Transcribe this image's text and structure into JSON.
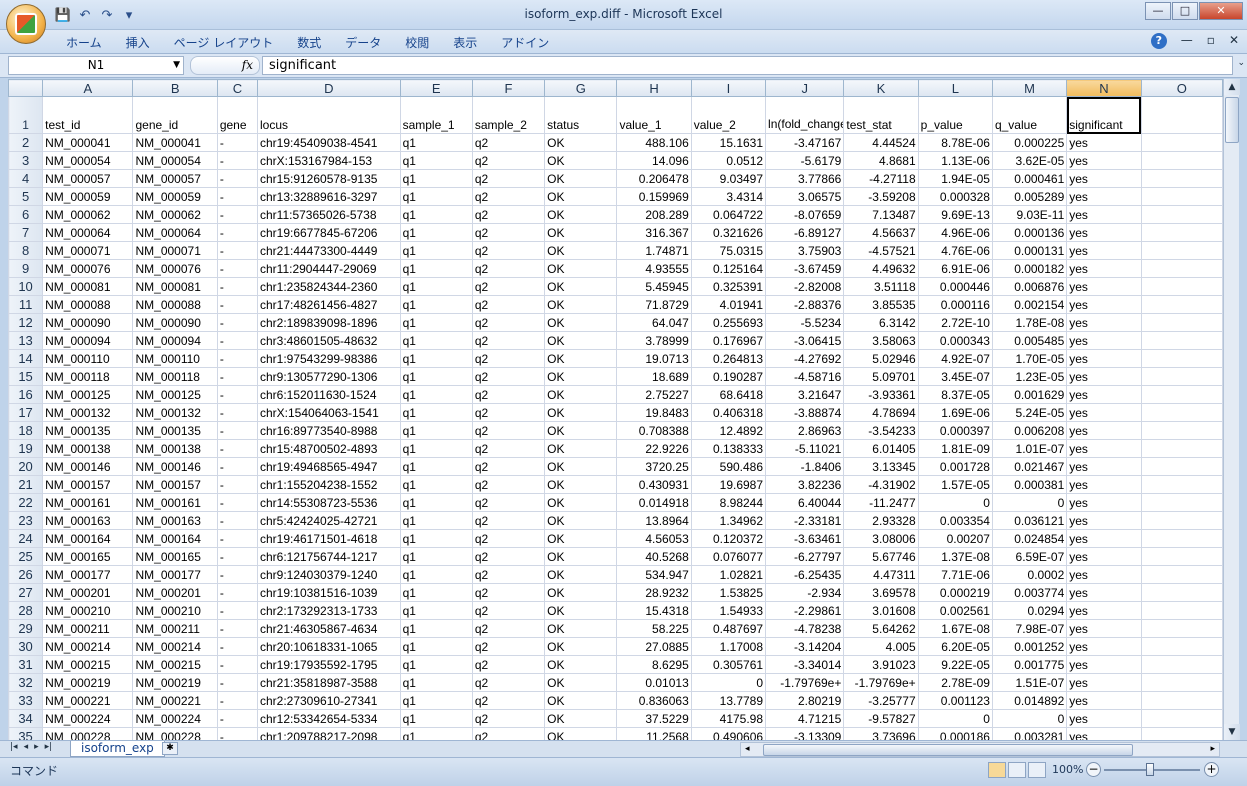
{
  "window": {
    "title": "isoform_exp.diff - Microsoft Excel",
    "controls": {
      "minimize": "—",
      "maximize": "□",
      "close": "✕"
    }
  },
  "quick_access": {
    "save": "💾",
    "undo": "↶",
    "redo": "↷",
    "customize": "▾"
  },
  "ribbon": {
    "tabs": [
      "ホーム",
      "挿入",
      "ページ レイアウト",
      "数式",
      "データ",
      "校閲",
      "表示",
      "アドイン"
    ],
    "help": "?",
    "doc_min": "—",
    "doc_restore": "▫",
    "doc_close": "✕"
  },
  "formula_bar": {
    "name_box": "N1",
    "fx": "fx",
    "content": "significant"
  },
  "columns": [
    "A",
    "B",
    "C",
    "D",
    "E",
    "F",
    "G",
    "H",
    "I",
    "J",
    "K",
    "L",
    "M",
    "N",
    "O"
  ],
  "selected_column": "N",
  "header_row": {
    "row": "1",
    "cells": [
      "test_id",
      "gene_id",
      "gene",
      "locus",
      "sample_1",
      "sample_2",
      "status",
      "value_1",
      "value_2",
      "ln(fold_change)",
      "test_stat",
      "p_value",
      "q_value",
      "significant",
      ""
    ]
  },
  "rows": [
    {
      "n": "2",
      "test_id": "NM_000041",
      "gene_id": "NM_000041",
      "gene": "-",
      "locus": "chr19:45409038-4541",
      "s1": "q1",
      "s2": "q2",
      "status": "OK",
      "v1": "488.106",
      "v2": "15.1631",
      "lfc": "-3.47167",
      "ts": "4.44524",
      "p": "8.78E-06",
      "q": "0.000225",
      "sig": "yes"
    },
    {
      "n": "3",
      "test_id": "NM_000054",
      "gene_id": "NM_000054",
      "gene": "-",
      "locus": "chrX:153167984-153",
      "s1": "q1",
      "s2": "q2",
      "status": "OK",
      "v1": "14.096",
      "v2": "0.0512",
      "lfc": "-5.6179",
      "ts": "4.8681",
      "p": "1.13E-06",
      "q": "3.62E-05",
      "sig": "yes"
    },
    {
      "n": "4",
      "test_id": "NM_000057",
      "gene_id": "NM_000057",
      "gene": "-",
      "locus": "chr15:91260578-9135",
      "s1": "q1",
      "s2": "q2",
      "status": "OK",
      "v1": "0.206478",
      "v2": "9.03497",
      "lfc": "3.77866",
      "ts": "-4.27118",
      "p": "1.94E-05",
      "q": "0.000461",
      "sig": "yes"
    },
    {
      "n": "5",
      "test_id": "NM_000059",
      "gene_id": "NM_000059",
      "gene": "-",
      "locus": "chr13:32889616-3297",
      "s1": "q1",
      "s2": "q2",
      "status": "OK",
      "v1": "0.159969",
      "v2": "3.4314",
      "lfc": "3.06575",
      "ts": "-3.59208",
      "p": "0.000328",
      "q": "0.005289",
      "sig": "yes"
    },
    {
      "n": "6",
      "test_id": "NM_000062",
      "gene_id": "NM_000062",
      "gene": "-",
      "locus": "chr11:57365026-5738",
      "s1": "q1",
      "s2": "q2",
      "status": "OK",
      "v1": "208.289",
      "v2": "0.064722",
      "lfc": "-8.07659",
      "ts": "7.13487",
      "p": "9.69E-13",
      "q": "9.03E-11",
      "sig": "yes"
    },
    {
      "n": "7",
      "test_id": "NM_000064",
      "gene_id": "NM_000064",
      "gene": "-",
      "locus": "chr19:6677845-67206",
      "s1": "q1",
      "s2": "q2",
      "status": "OK",
      "v1": "316.367",
      "v2": "0.321626",
      "lfc": "-6.89127",
      "ts": "4.56637",
      "p": "4.96E-06",
      "q": "0.000136",
      "sig": "yes"
    },
    {
      "n": "8",
      "test_id": "NM_000071",
      "gene_id": "NM_000071",
      "gene": "-",
      "locus": "chr21:44473300-4449",
      "s1": "q1",
      "s2": "q2",
      "status": "OK",
      "v1": "1.74871",
      "v2": "75.0315",
      "lfc": "3.75903",
      "ts": "-4.57521",
      "p": "4.76E-06",
      "q": "0.000131",
      "sig": "yes"
    },
    {
      "n": "9",
      "test_id": "NM_000076",
      "gene_id": "NM_000076",
      "gene": "-",
      "locus": "chr11:2904447-29069",
      "s1": "q1",
      "s2": "q2",
      "status": "OK",
      "v1": "4.93555",
      "v2": "0.125164",
      "lfc": "-3.67459",
      "ts": "4.49632",
      "p": "6.91E-06",
      "q": "0.000182",
      "sig": "yes"
    },
    {
      "n": "10",
      "test_id": "NM_000081",
      "gene_id": "NM_000081",
      "gene": "-",
      "locus": "chr1:235824344-2360",
      "s1": "q1",
      "s2": "q2",
      "status": "OK",
      "v1": "5.45945",
      "v2": "0.325391",
      "lfc": "-2.82008",
      "ts": "3.51118",
      "p": "0.000446",
      "q": "0.006876",
      "sig": "yes"
    },
    {
      "n": "11",
      "test_id": "NM_000088",
      "gene_id": "NM_000088",
      "gene": "-",
      "locus": "chr17:48261456-4827",
      "s1": "q1",
      "s2": "q2",
      "status": "OK",
      "v1": "71.8729",
      "v2": "4.01941",
      "lfc": "-2.88376",
      "ts": "3.85535",
      "p": "0.000116",
      "q": "0.002154",
      "sig": "yes"
    },
    {
      "n": "12",
      "test_id": "NM_000090",
      "gene_id": "NM_000090",
      "gene": "-",
      "locus": "chr2:189839098-1896",
      "s1": "q1",
      "s2": "q2",
      "status": "OK",
      "v1": "64.047",
      "v2": "0.255693",
      "lfc": "-5.5234",
      "ts": "6.3142",
      "p": "2.72E-10",
      "q": "1.78E-08",
      "sig": "yes"
    },
    {
      "n": "13",
      "test_id": "NM_000094",
      "gene_id": "NM_000094",
      "gene": "-",
      "locus": "chr3:48601505-48632",
      "s1": "q1",
      "s2": "q2",
      "status": "OK",
      "v1": "3.78999",
      "v2": "0.176967",
      "lfc": "-3.06415",
      "ts": "3.58063",
      "p": "0.000343",
      "q": "0.005485",
      "sig": "yes"
    },
    {
      "n": "14",
      "test_id": "NM_000110",
      "gene_id": "NM_000110",
      "gene": "-",
      "locus": "chr1:97543299-98386",
      "s1": "q1",
      "s2": "q2",
      "status": "OK",
      "v1": "19.0713",
      "v2": "0.264813",
      "lfc": "-4.27692",
      "ts": "5.02946",
      "p": "4.92E-07",
      "q": "1.70E-05",
      "sig": "yes"
    },
    {
      "n": "15",
      "test_id": "NM_000118",
      "gene_id": "NM_000118",
      "gene": "-",
      "locus": "chr9:130577290-1306",
      "s1": "q1",
      "s2": "q2",
      "status": "OK",
      "v1": "18.689",
      "v2": "0.190287",
      "lfc": "-4.58716",
      "ts": "5.09701",
      "p": "3.45E-07",
      "q": "1.23E-05",
      "sig": "yes"
    },
    {
      "n": "16",
      "test_id": "NM_000125",
      "gene_id": "NM_000125",
      "gene": "-",
      "locus": "chr6:152011630-1524",
      "s1": "q1",
      "s2": "q2",
      "status": "OK",
      "v1": "2.75227",
      "v2": "68.6418",
      "lfc": "3.21647",
      "ts": "-3.93361",
      "p": "8.37E-05",
      "q": "0.001629",
      "sig": "yes"
    },
    {
      "n": "17",
      "test_id": "NM_000132",
      "gene_id": "NM_000132",
      "gene": "-",
      "locus": "chrX:154064063-1541",
      "s1": "q1",
      "s2": "q2",
      "status": "OK",
      "v1": "19.8483",
      "v2": "0.406318",
      "lfc": "-3.88874",
      "ts": "4.78694",
      "p": "1.69E-06",
      "q": "5.24E-05",
      "sig": "yes"
    },
    {
      "n": "18",
      "test_id": "NM_000135",
      "gene_id": "NM_000135",
      "gene": "-",
      "locus": "chr16:89773540-8988",
      "s1": "q1",
      "s2": "q2",
      "status": "OK",
      "v1": "0.708388",
      "v2": "12.4892",
      "lfc": "2.86963",
      "ts": "-3.54233",
      "p": "0.000397",
      "q": "0.006208",
      "sig": "yes"
    },
    {
      "n": "19",
      "test_id": "NM_000138",
      "gene_id": "NM_000138",
      "gene": "-",
      "locus": "chr15:48700502-4893",
      "s1": "q1",
      "s2": "q2",
      "status": "OK",
      "v1": "22.9226",
      "v2": "0.138333",
      "lfc": "-5.11021",
      "ts": "6.01405",
      "p": "1.81E-09",
      "q": "1.01E-07",
      "sig": "yes"
    },
    {
      "n": "20",
      "test_id": "NM_000146",
      "gene_id": "NM_000146",
      "gene": "-",
      "locus": "chr19:49468565-4947",
      "s1": "q1",
      "s2": "q2",
      "status": "OK",
      "v1": "3720.25",
      "v2": "590.486",
      "lfc": "-1.8406",
      "ts": "3.13345",
      "p": "0.001728",
      "q": "0.021467",
      "sig": "yes"
    },
    {
      "n": "21",
      "test_id": "NM_000157",
      "gene_id": "NM_000157",
      "gene": "-",
      "locus": "chr1:155204238-1552",
      "s1": "q1",
      "s2": "q2",
      "status": "OK",
      "v1": "0.430931",
      "v2": "19.6987",
      "lfc": "3.82236",
      "ts": "-4.31902",
      "p": "1.57E-05",
      "q": "0.000381",
      "sig": "yes"
    },
    {
      "n": "22",
      "test_id": "NM_000161",
      "gene_id": "NM_000161",
      "gene": "-",
      "locus": "chr14:55308723-5536",
      "s1": "q1",
      "s2": "q2",
      "status": "OK",
      "v1": "0.014918",
      "v2": "8.98244",
      "lfc": "6.40044",
      "ts": "-11.2477",
      "p": "0",
      "q": "0",
      "sig": "yes"
    },
    {
      "n": "23",
      "test_id": "NM_000163",
      "gene_id": "NM_000163",
      "gene": "-",
      "locus": "chr5:42424025-42721",
      "s1": "q1",
      "s2": "q2",
      "status": "OK",
      "v1": "13.8964",
      "v2": "1.34962",
      "lfc": "-2.33181",
      "ts": "2.93328",
      "p": "0.003354",
      "q": "0.036121",
      "sig": "yes"
    },
    {
      "n": "24",
      "test_id": "NM_000164",
      "gene_id": "NM_000164",
      "gene": "-",
      "locus": "chr19:46171501-4618",
      "s1": "q1",
      "s2": "q2",
      "status": "OK",
      "v1": "4.56053",
      "v2": "0.120372",
      "lfc": "-3.63461",
      "ts": "3.08006",
      "p": "0.00207",
      "q": "0.024854",
      "sig": "yes"
    },
    {
      "n": "25",
      "test_id": "NM_000165",
      "gene_id": "NM_000165",
      "gene": "-",
      "locus": "chr6:121756744-1217",
      "s1": "q1",
      "s2": "q2",
      "status": "OK",
      "v1": "40.5268",
      "v2": "0.076077",
      "lfc": "-6.27797",
      "ts": "5.67746",
      "p": "1.37E-08",
      "q": "6.59E-07",
      "sig": "yes"
    },
    {
      "n": "26",
      "test_id": "NM_000177",
      "gene_id": "NM_000177",
      "gene": "-",
      "locus": "chr9:124030379-1240",
      "s1": "q1",
      "s2": "q2",
      "status": "OK",
      "v1": "534.947",
      "v2": "1.02821",
      "lfc": "-6.25435",
      "ts": "4.47311",
      "p": "7.71E-06",
      "q": "0.0002",
      "sig": "yes"
    },
    {
      "n": "27",
      "test_id": "NM_000201",
      "gene_id": "NM_000201",
      "gene": "-",
      "locus": "chr19:10381516-1039",
      "s1": "q1",
      "s2": "q2",
      "status": "OK",
      "v1": "28.9232",
      "v2": "1.53825",
      "lfc": "-2.934",
      "ts": "3.69578",
      "p": "0.000219",
      "q": "0.003774",
      "sig": "yes"
    },
    {
      "n": "28",
      "test_id": "NM_000210",
      "gene_id": "NM_000210",
      "gene": "-",
      "locus": "chr2:173292313-1733",
      "s1": "q1",
      "s2": "q2",
      "status": "OK",
      "v1": "15.4318",
      "v2": "1.54933",
      "lfc": "-2.29861",
      "ts": "3.01608",
      "p": "0.002561",
      "q": "0.0294",
      "sig": "yes"
    },
    {
      "n": "29",
      "test_id": "NM_000211",
      "gene_id": "NM_000211",
      "gene": "-",
      "locus": "chr21:46305867-4634",
      "s1": "q1",
      "s2": "q2",
      "status": "OK",
      "v1": "58.225",
      "v2": "0.487697",
      "lfc": "-4.78238",
      "ts": "5.64262",
      "p": "1.67E-08",
      "q": "7.98E-07",
      "sig": "yes"
    },
    {
      "n": "30",
      "test_id": "NM_000214",
      "gene_id": "NM_000214",
      "gene": "-",
      "locus": "chr20:10618331-1065",
      "s1": "q1",
      "s2": "q2",
      "status": "OK",
      "v1": "27.0885",
      "v2": "1.17008",
      "lfc": "-3.14204",
      "ts": "4.005",
      "p": "6.20E-05",
      "q": "0.001252",
      "sig": "yes"
    },
    {
      "n": "31",
      "test_id": "NM_000215",
      "gene_id": "NM_000215",
      "gene": "-",
      "locus": "chr19:17935592-1795",
      "s1": "q1",
      "s2": "q2",
      "status": "OK",
      "v1": "8.6295",
      "v2": "0.305761",
      "lfc": "-3.34014",
      "ts": "3.91023",
      "p": "9.22E-05",
      "q": "0.001775",
      "sig": "yes"
    },
    {
      "n": "32",
      "test_id": "NM_000219",
      "gene_id": "NM_000219",
      "gene": "-",
      "locus": "chr21:35818987-3588",
      "s1": "q1",
      "s2": "q2",
      "status": "OK",
      "v1": "0.01013",
      "v2": "0",
      "lfc": "-1.79769e+",
      "ts": "-1.79769e+",
      "p": "2.78E-09",
      "q": "1.51E-07",
      "sig": "yes"
    },
    {
      "n": "33",
      "test_id": "NM_000221",
      "gene_id": "NM_000221",
      "gene": "-",
      "locus": "chr2:27309610-27341",
      "s1": "q1",
      "s2": "q2",
      "status": "OK",
      "v1": "0.836063",
      "v2": "13.7789",
      "lfc": "2.80219",
      "ts": "-3.25777",
      "p": "0.001123",
      "q": "0.014892",
      "sig": "yes"
    },
    {
      "n": "34",
      "test_id": "NM_000224",
      "gene_id": "NM_000224",
      "gene": "-",
      "locus": "chr12:53342654-5334",
      "s1": "q1",
      "s2": "q2",
      "status": "OK",
      "v1": "37.5229",
      "v2": "4175.98",
      "lfc": "4.71215",
      "ts": "-9.57827",
      "p": "0",
      "q": "0",
      "sig": "yes"
    },
    {
      "n": "35",
      "test_id": "NM_000228",
      "gene_id": "NM_000228",
      "gene": "-",
      "locus": "chr1:209788217-2098",
      "s1": "q1",
      "s2": "q2",
      "status": "OK",
      "v1": "11.2568",
      "v2": "0.490606",
      "lfc": "-3.13309",
      "ts": "3.73696",
      "p": "0.000186",
      "q": "0.003281",
      "sig": "yes"
    }
  ],
  "sheet_tabs": {
    "nav": [
      "|◂",
      "◂",
      "▸",
      "▸|"
    ],
    "active": "isoform_exp"
  },
  "status_bar": {
    "mode": "コマンド",
    "zoom": "100%",
    "zoom_minus": "−",
    "zoom_plus": "+"
  },
  "scroll": {
    "up": "▲",
    "down": "▼",
    "left": "◂",
    "right": "▸"
  }
}
